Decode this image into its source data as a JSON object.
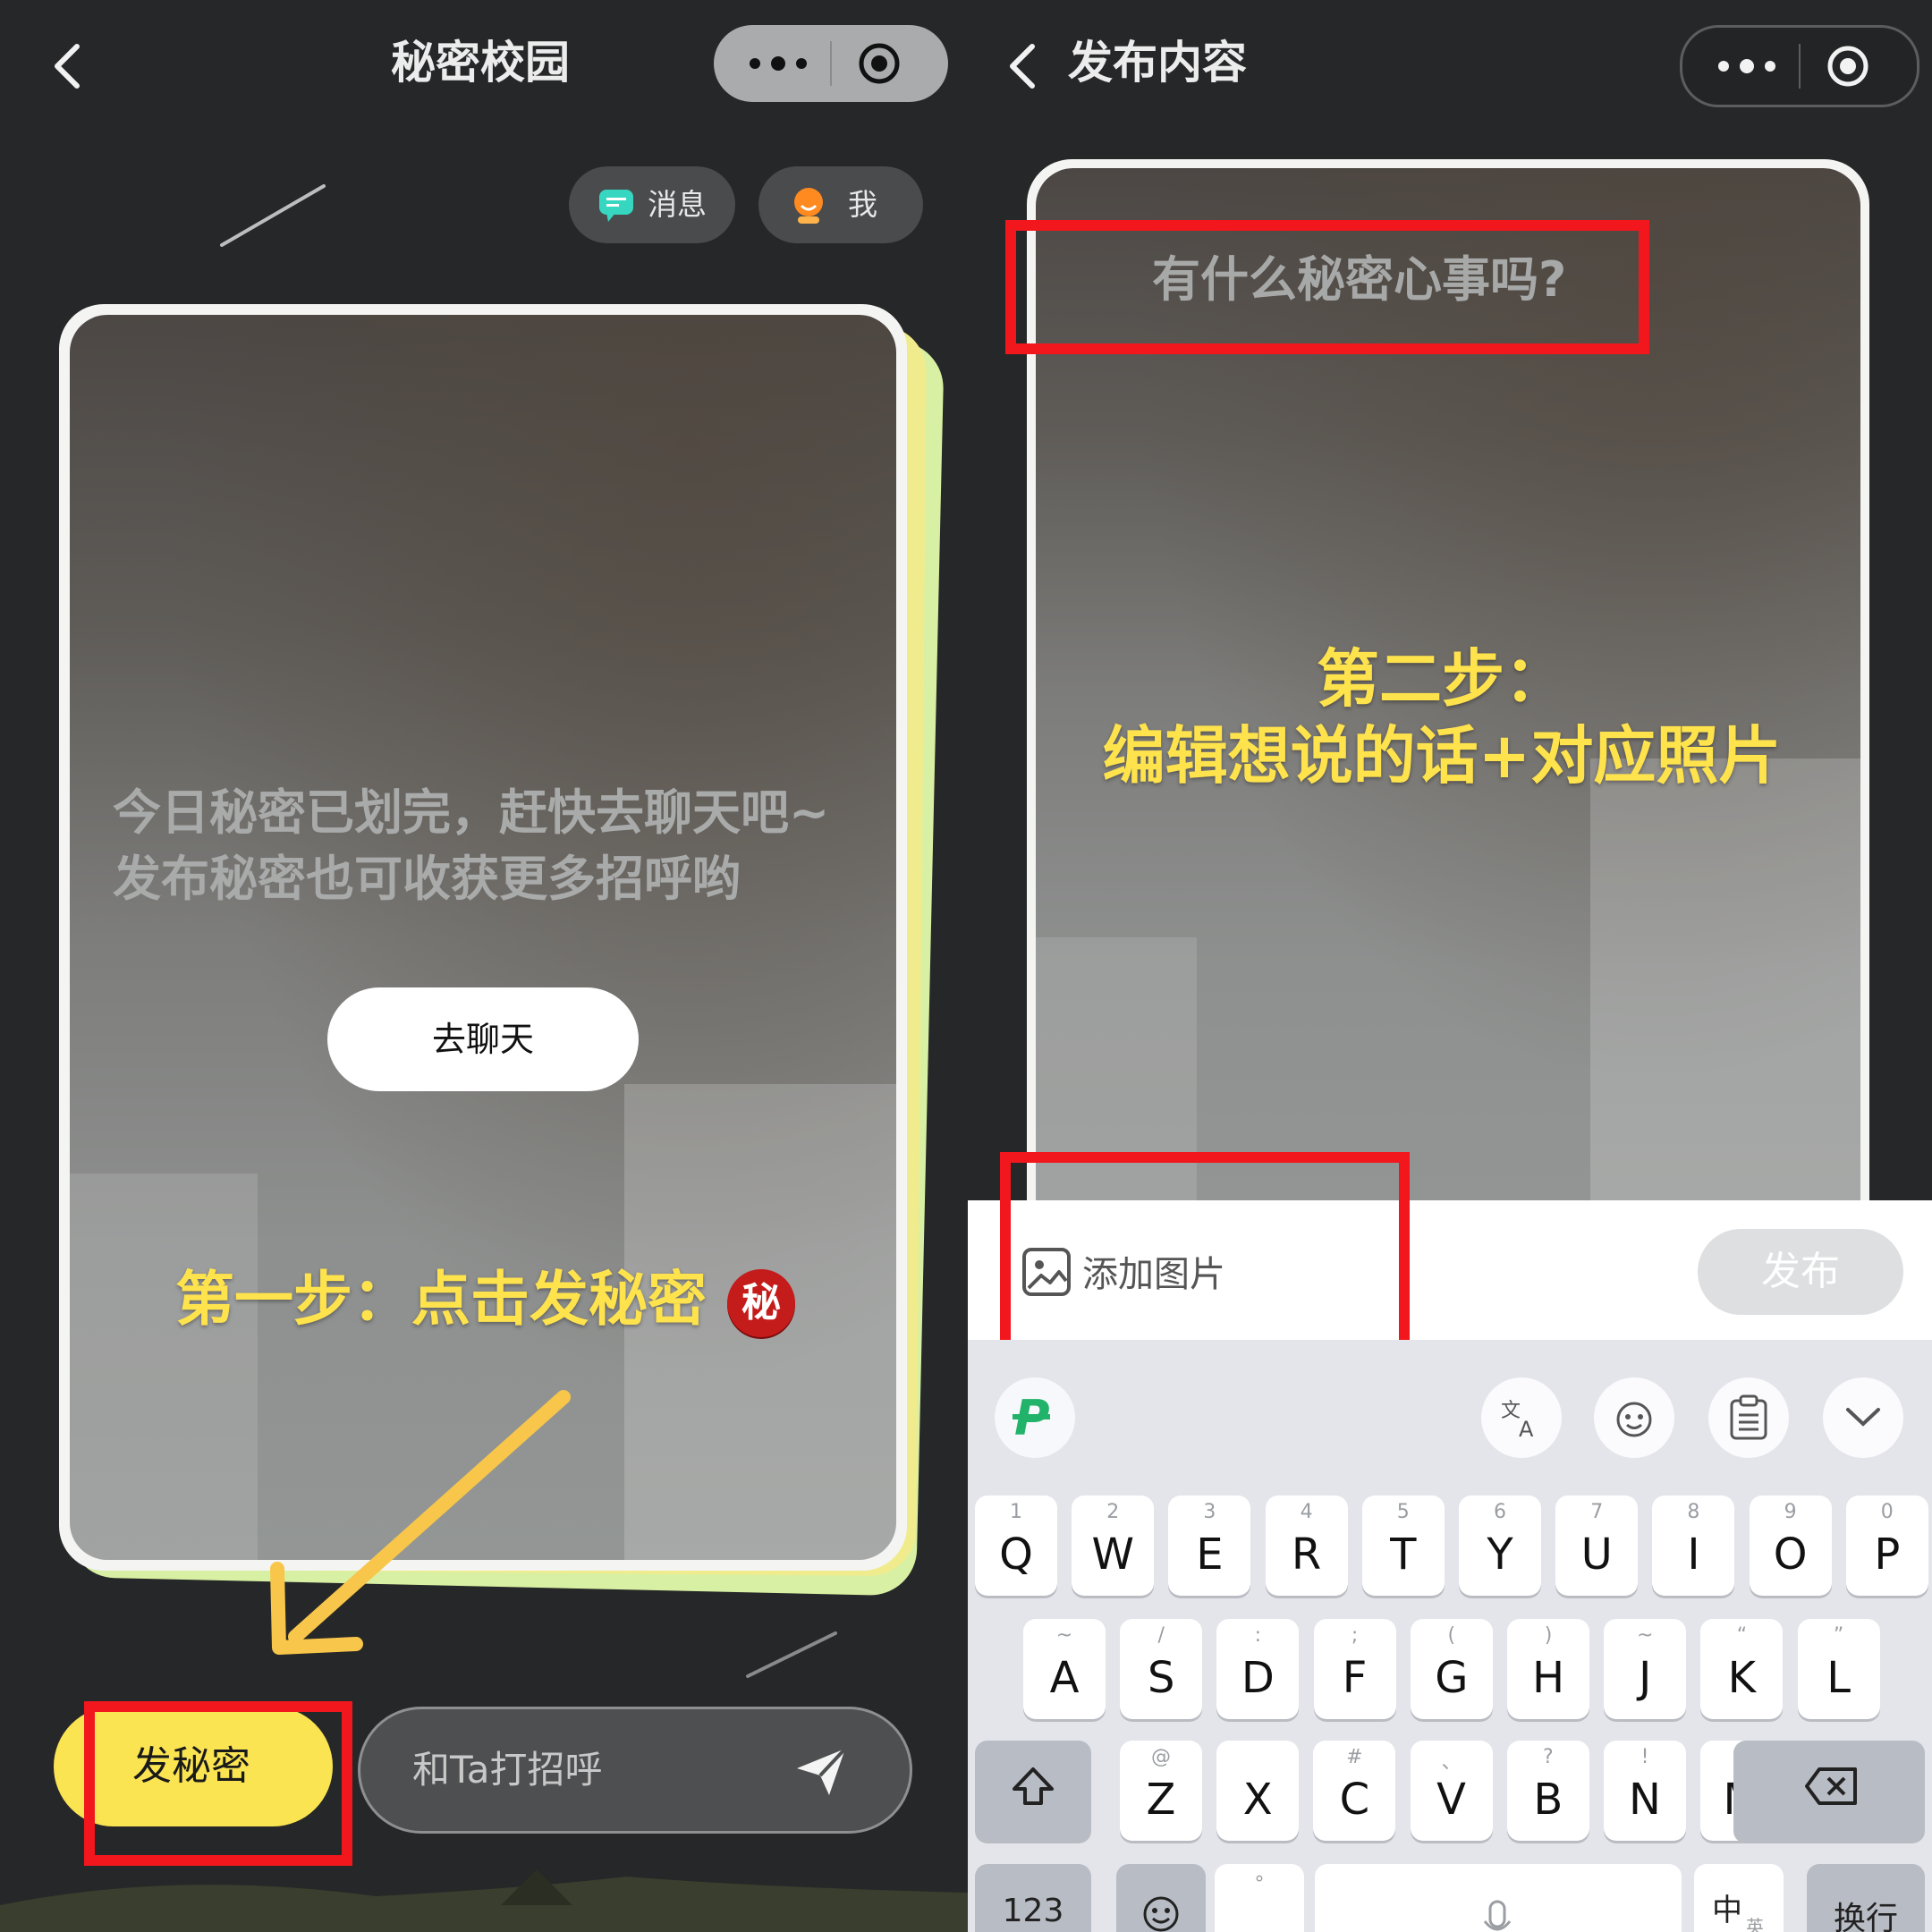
{
  "left": {
    "title": "秘密校园",
    "nav": {
      "messages": "消息",
      "me": "我"
    },
    "card_text": "今日秘密已划完，赶快去聊天吧~发布秘密也可收获更多招呼哟",
    "chat_button": "去聊天",
    "step_note": "第一步：点击发秘密",
    "step_badge": "秘",
    "post_button": "发秘密",
    "greet_placeholder": "和Ta打招呼"
  },
  "right": {
    "title": "发布内容",
    "input_placeholder": "有什么秘密心事吗?",
    "step_note_line1": "第二步：",
    "step_note_line2": "编辑想说的话+对应照片",
    "add_image": "添加图片",
    "publish": "发布",
    "keyboard": {
      "row1": [
        {
          "k": "Q",
          "s": "1"
        },
        {
          "k": "W",
          "s": "2"
        },
        {
          "k": "E",
          "s": "3"
        },
        {
          "k": "R",
          "s": "4"
        },
        {
          "k": "T",
          "s": "5"
        },
        {
          "k": "Y",
          "s": "6"
        },
        {
          "k": "U",
          "s": "7"
        },
        {
          "k": "I",
          "s": "8"
        },
        {
          "k": "O",
          "s": "9"
        },
        {
          "k": "P",
          "s": "0"
        }
      ],
      "row2": [
        {
          "k": "A",
          "s": "~"
        },
        {
          "k": "S",
          "s": "/"
        },
        {
          "k": "D",
          "s": ":"
        },
        {
          "k": "F",
          "s": ";"
        },
        {
          "k": "G",
          "s": "("
        },
        {
          "k": "H",
          "s": ")"
        },
        {
          "k": "J",
          "s": "~"
        },
        {
          "k": "K",
          "s": "“"
        },
        {
          "k": "L",
          "s": "”"
        }
      ],
      "row3": [
        {
          "k": "Z",
          "s": "@"
        },
        {
          "k": "X",
          "s": ""
        },
        {
          "k": "C",
          "s": "#"
        },
        {
          "k": "V",
          "s": "、"
        },
        {
          "k": "B",
          "s": "?"
        },
        {
          "k": "N",
          "s": "!"
        },
        {
          "k": "M",
          "s": "…"
        }
      ],
      "numbers": "123",
      "lang": "中",
      "lang_sub": "英",
      "enter": "换行"
    }
  },
  "colors": {
    "accent_yellow": "#ffe34d",
    "highlight_red": "#f2171d",
    "bg_dark": "#262728"
  }
}
